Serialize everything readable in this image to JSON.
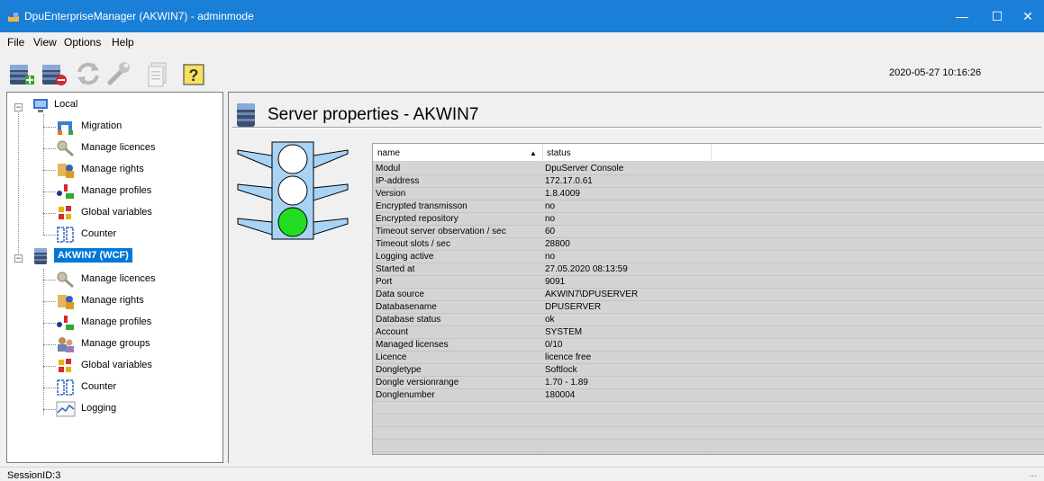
{
  "window": {
    "title": "DpuEnterpriseManager (AKWIN7) - adminmode",
    "controls": {
      "minimize": "—",
      "maximize": "☐",
      "close": "✕"
    }
  },
  "menu": [
    "File",
    "View",
    "Options",
    "Help"
  ],
  "toolbar": {
    "buttons": [
      "add-server-icon",
      "remove-server-icon",
      "refresh-icon",
      "settings-wrench-icon",
      "document-icon",
      "help-icon"
    ],
    "datetime": "2020-05-27 10:16:26"
  },
  "tree": {
    "local": {
      "label": "Local",
      "children": [
        "Migration",
        "Manage licences",
        "Manage rights",
        "Manage profiles",
        "Global variables",
        "Counter"
      ]
    },
    "server": {
      "label": "AKWIN7 (WCF)",
      "children": [
        "Manage licences",
        "Manage rights",
        "Manage profiles",
        "Manage groups",
        "Global variables",
        "Counter",
        "Logging"
      ]
    }
  },
  "panel": {
    "title": "Server properties - AKWIN7",
    "traffic_light": {
      "active": "green"
    }
  },
  "table": {
    "columns": [
      "name",
      "status"
    ],
    "rows": [
      [
        "Modul",
        "DpuServer Console"
      ],
      [
        "IP-address",
        "172.17.0.61"
      ],
      [
        "Version",
        "1.8.4009"
      ],
      [
        "Encrypted transmisson",
        "no"
      ],
      [
        "Encrypted repository",
        "no"
      ],
      [
        "Timeout server observation / sec",
        "60"
      ],
      [
        "Timeout slots / sec",
        "28800"
      ],
      [
        "Logging active",
        "no"
      ],
      [
        "Started at",
        "27.05.2020 08:13:59"
      ],
      [
        "Port",
        "9091"
      ],
      [
        "Data source",
        "AKWIN7\\DPUSERVER"
      ],
      [
        "Databasename",
        "DPUSERVER"
      ],
      [
        "Database status",
        "ok"
      ],
      [
        "Account",
        "SYSTEM"
      ],
      [
        "Managed licenses",
        "0/10"
      ],
      [
        "Licence",
        "licence free"
      ],
      [
        "Dongletype",
        "Softlock"
      ],
      [
        "Dongle versionrange",
        "1.70 - 1.89"
      ],
      [
        "Donglenumber",
        "180004"
      ],
      [
        "",
        ""
      ],
      [
        "",
        ""
      ],
      [
        "",
        ""
      ],
      [
        "",
        ""
      ]
    ]
  },
  "status": {
    "session": "SessionID:3",
    "grip": "..."
  },
  "colors": {
    "titlebar": "#1a7fd7",
    "selection": "#0078d7",
    "light_on": "#22dd22",
    "light_body": "#a9d3f5"
  }
}
